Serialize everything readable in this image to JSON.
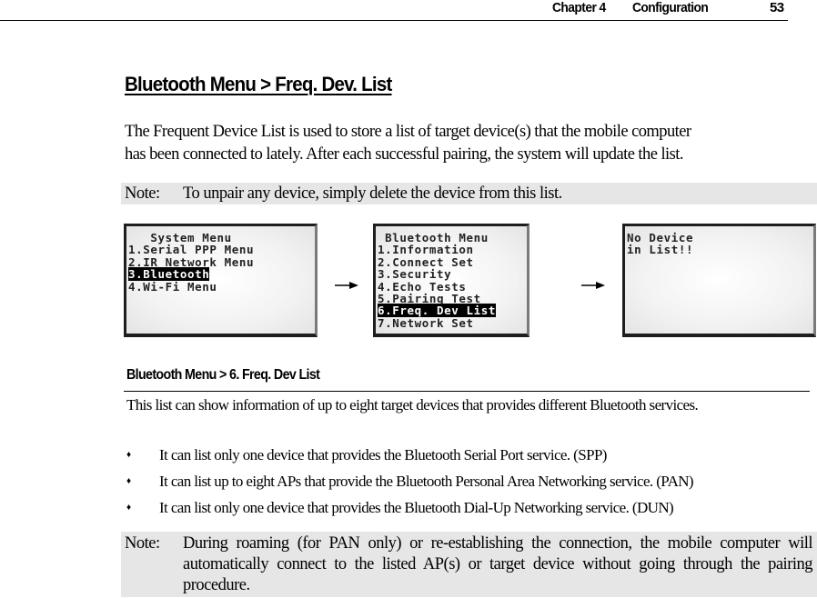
{
  "page_header": {
    "chapter": "Chapter 4",
    "title": "Configuration",
    "page_number": "53"
  },
  "section": {
    "title": "Bluetooth Menu > Freq. Dev. List",
    "intro_lines": [
      "The Frequent Device List is used to store a list of target device(s) that the mobile computer",
      "has been connected to lately. After each successful pairing, the system will update the list."
    ],
    "note1": {
      "label": "Note:",
      "text": "To unpair any device, simply delete the device from this list."
    }
  },
  "screens": [
    {
      "name": "system-menu",
      "lines": [
        {
          "text": "System Menu",
          "center": true,
          "selected": false
        },
        {
          "text": "1.Serial PPP Menu",
          "center": false,
          "selected": false
        },
        {
          "text": "2.IR Network Menu",
          "center": false,
          "selected": false
        },
        {
          "text": "3.Bluetooth",
          "center": false,
          "selected": true
        },
        {
          "text": "4.Wi-Fi Menu",
          "center": false,
          "selected": false
        }
      ]
    },
    {
      "name": "bluetooth-menu",
      "lines": [
        {
          "text": "Bluetooth Menu",
          "center": true,
          "selected": false
        },
        {
          "text": "1.Information",
          "center": false,
          "selected": false
        },
        {
          "text": "2.Connect Set",
          "center": false,
          "selected": false
        },
        {
          "text": "3.Security",
          "center": false,
          "selected": false
        },
        {
          "text": "4.Echo Tests",
          "center": false,
          "selected": false
        },
        {
          "text": "5.Pairing Test",
          "center": false,
          "selected": false
        },
        {
          "text": "6.Freq. Dev List",
          "center": false,
          "selected": true
        },
        {
          "text": "7.Network Set",
          "center": false,
          "selected": false
        }
      ]
    },
    {
      "name": "freq-dev-list",
      "lines": [
        {
          "text": "No Device",
          "center": false,
          "selected": false
        },
        {
          "text": "in List!!",
          "center": false,
          "selected": false
        }
      ]
    }
  ],
  "subsection": {
    "heading": "Bluetooth Menu > 6. Freq. Dev List",
    "description": "This list can show information of up to eight target devices that provides different Bluetooth services.",
    "bullet_symbol": "♦",
    "bullets": [
      "It can list only one device that provides the Bluetooth Serial Port service. (SPP)",
      "It can list up to eight APs that provide the Bluetooth Personal Area Networking service. (PAN)",
      "It can list only one device that provides the Bluetooth Dial-Up Networking service. (DUN)"
    ],
    "note2": {
      "label": "Note:",
      "text": "During roaming (for PAN only) or re-establishing the connection, the mobile computer will automatically connect to the listed AP(s) or target device without going through the pairing procedure."
    }
  },
  "colors": {
    "note_background": "#e6e6e6",
    "screen_border": "#1e1e1e",
    "selection_background": "#000000"
  }
}
